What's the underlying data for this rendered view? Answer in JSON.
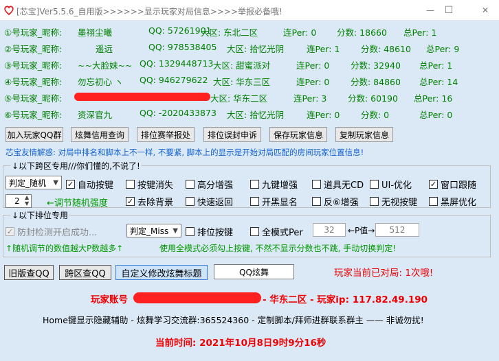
{
  "window": {
    "title": "[芯宝]Ver5.5.6_自用版>>>>>>显示玩家对局信息>>>>举报必备哦!",
    "min": "—",
    "max": "☐",
    "close": "✕"
  },
  "players": [
    {
      "label": "①号玩家_昵称:",
      "nick": "墨祤尘曦",
      "qq": "QQ: 57261901",
      "area": "大区: 东北二区",
      "lian": "连Per: 0",
      "score": "分数: 18660",
      "total": "总Per: 1"
    },
    {
      "label": "②号玩家_昵称:",
      "nick": "遥远",
      "qq": "QQ: 978538405",
      "area": "大区: 拾忆光阴",
      "lian": "连Per: 1",
      "score": "分数: 48610",
      "total": "总Per: 9"
    },
    {
      "label": "③号玩家_昵称:",
      "nick": "~~大脸妹~~",
      "qq": "QQ: 1329448713",
      "area": "大区: 甜蜜派对",
      "lian": "连Per: 0",
      "score": "分数: 32940",
      "total": "总Per: 1"
    },
    {
      "label": "④号玩家_昵称:",
      "nick": "勿忘初心 ヽ",
      "qq": "QQ: 946279622",
      "area": "大区: 华东三区",
      "lian": "连Per: 0",
      "score": "分数: 84860",
      "total": "总Per: 14"
    },
    {
      "label": "⑤号玩家_昵称:",
      "nick": "",
      "qq": "",
      "area": "大区: 华东二区",
      "lian": "连Per: 3",
      "score": "分数: 60190",
      "total": "总Per: 16"
    },
    {
      "label": "⑥号玩家_昵称:",
      "nick": "资深官九",
      "qq": "QQ: -2020433873",
      "area": "大区: 拾忆光阴",
      "lian": "连Per: 0",
      "score": "分数: 0",
      "total": "总Per: 0"
    }
  ],
  "buttons_row": [
    "加入玩家QQ群",
    "炫舞信用查询",
    "排位赛举报处",
    "排位误封申诉",
    "保存玩家信息",
    "复制玩家信息"
  ],
  "notice": "芯宝友情解惑: 对局中排名和脚本上不一样, 不要紧, 脚本上的显示是开始对局匹配的房间玩家位置信息!",
  "group1": {
    "legend": "↓以下跨区专用///你们懂的,不说了!",
    "mode_select": "判定_随机",
    "stepper_value": "2",
    "stepper_label": "←调节随机强度",
    "checks": [
      {
        "label": "自动按键",
        "checked": true
      },
      {
        "label": "按键消失",
        "checked": false
      },
      {
        "label": "高分增强",
        "checked": false
      },
      {
        "label": "九键增强",
        "checked": false
      },
      {
        "label": "道具无CD",
        "checked": false
      },
      {
        "label": "UI-优化",
        "checked": false
      },
      {
        "label": "窗口跟随",
        "checked": true
      },
      {
        "label": "去除背景",
        "checked": true
      },
      {
        "label": "快速返回",
        "checked": false
      },
      {
        "label": "开黑显名",
        "checked": false
      },
      {
        "label": "反⑥增强",
        "checked": false
      },
      {
        "label": "无视按键",
        "checked": false
      },
      {
        "label": "黑屏优化",
        "checked": false
      }
    ]
  },
  "group2": {
    "legend": "↓以下排位专用",
    "anti_detect": "防封检测开启成功...",
    "mode_select": "判定_Miss",
    "rank_key": "排位按键",
    "all_mode": "全模式Per",
    "per_from": "32",
    "per_mid": "←P值→",
    "per_to": "512",
    "hint_left": "↑随机调节的数值越大P数越多↑",
    "hint_right": "使用全模式必须勾上按键, 不然不显示分数也不跳, 手动切换判定!"
  },
  "bottom_buttons": {
    "old_qq": "旧版查QQ",
    "cross_qq": "跨区查QQ",
    "custom_title": "自定义修改炫舞标题",
    "title_input": "QQ炫舞",
    "match_count": "玩家当前已对局: 1次哦!"
  },
  "account_line": {
    "prefix": "玩家账号",
    "suffix": "- 华东二区 - 玩家ip: 117.82.49.190"
  },
  "footer": {
    "hotkey_line": "Home键显示隐藏辅助 - 炫舞学习交流群:365524360 - 定制脚本/拜师进群联系群主 —— 非诚勿扰!",
    "time_line": "当前时间: 2021年10月8日9时9分16秒"
  }
}
